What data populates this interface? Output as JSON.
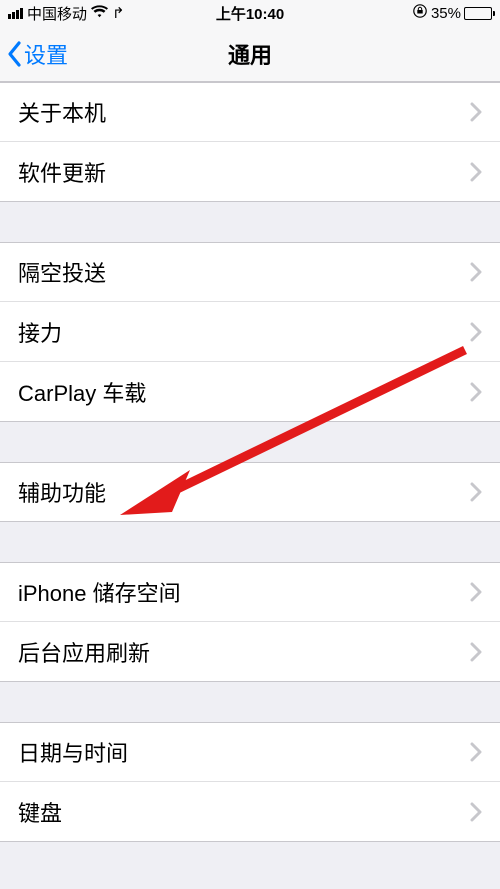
{
  "status": {
    "carrier": "中国移动",
    "time": "上午10:40",
    "battery_pct": "35%"
  },
  "nav": {
    "back_label": "设置",
    "title": "通用"
  },
  "groups": [
    {
      "cells": [
        {
          "id": "about",
          "label": "关于本机"
        },
        {
          "id": "update",
          "label": "软件更新"
        }
      ]
    },
    {
      "cells": [
        {
          "id": "airdrop",
          "label": "隔空投送"
        },
        {
          "id": "handoff",
          "label": "接力"
        },
        {
          "id": "carplay",
          "label": "CarPlay 车载"
        }
      ]
    },
    {
      "cells": [
        {
          "id": "accessibility",
          "label": "辅助功能"
        }
      ]
    },
    {
      "cells": [
        {
          "id": "storage",
          "label": "iPhone 储存空间"
        },
        {
          "id": "bgrefresh",
          "label": "后台应用刷新"
        }
      ]
    },
    {
      "cells": [
        {
          "id": "datetime",
          "label": "日期与时间"
        },
        {
          "id": "keyboard",
          "label": "键盘"
        }
      ]
    }
  ],
  "annotation": {
    "target_id": "accessibility",
    "color": "#e21b1b"
  }
}
